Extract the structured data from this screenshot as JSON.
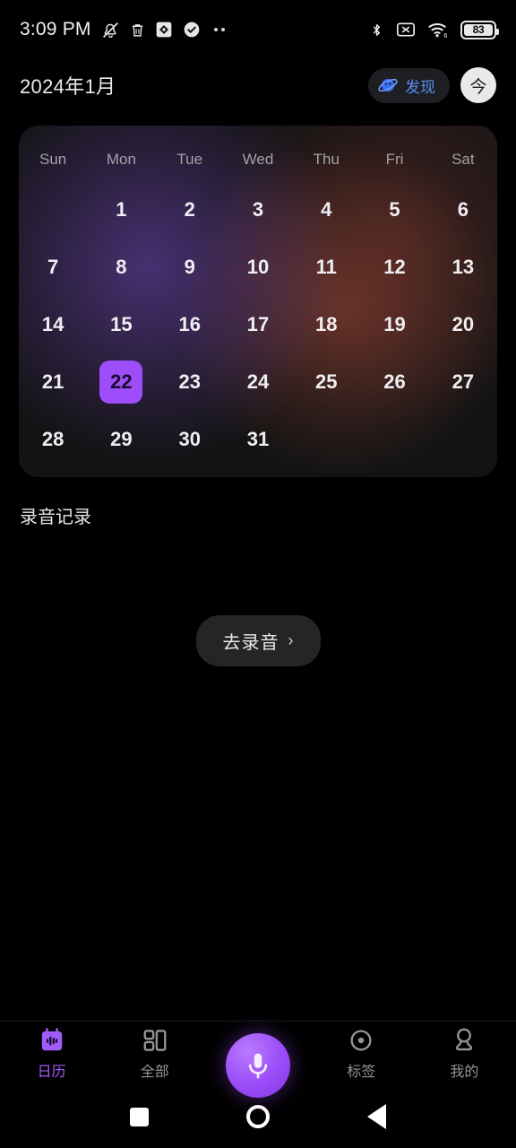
{
  "status_bar": {
    "time": "3:09 PM",
    "battery_percent": "83",
    "left_icons": [
      "bell-muted-icon",
      "trash-icon",
      "diamond-photo-icon",
      "check-circle-icon",
      "more-dots-icon"
    ],
    "right_icons": [
      "bluetooth-icon",
      "no-sim-icon",
      "wifi-6-icon",
      "battery-icon"
    ]
  },
  "header": {
    "title": "2024年1月",
    "discover_label": "发现",
    "discover_icon": "planet-icon",
    "today_label": "今"
  },
  "calendar": {
    "weekdays": [
      "Sun",
      "Mon",
      "Tue",
      "Wed",
      "Thu",
      "Fri",
      "Sat"
    ],
    "selected_day": "22",
    "accent_color": "#9d4dfa",
    "weeks": [
      [
        "",
        "1",
        "2",
        "3",
        "4",
        "5",
        "6"
      ],
      [
        "7",
        "8",
        "9",
        "10",
        "11",
        "12",
        "13"
      ],
      [
        "14",
        "15",
        "16",
        "17",
        "18",
        "19",
        "20"
      ],
      [
        "21",
        "22",
        "23",
        "24",
        "25",
        "26",
        "27"
      ],
      [
        "28",
        "29",
        "30",
        "31",
        "",
        "",
        ""
      ]
    ]
  },
  "records": {
    "section_title": "录音记录",
    "goto_label": "去录音",
    "chevron": "›"
  },
  "tabs": [
    {
      "label": "日历",
      "icon": "calendar-waveform-icon",
      "active": true
    },
    {
      "label": "全部",
      "icon": "grid-layout-icon",
      "active": false
    },
    {
      "label": "标签",
      "icon": "tag-circle-dot-icon",
      "active": false
    },
    {
      "label": "我的",
      "icon": "person-profile-icon",
      "active": false
    }
  ],
  "fab": {
    "icon": "microphone-icon"
  },
  "android_nav": [
    "recents-square-icon",
    "home-circle-icon",
    "back-triangle-icon"
  ]
}
